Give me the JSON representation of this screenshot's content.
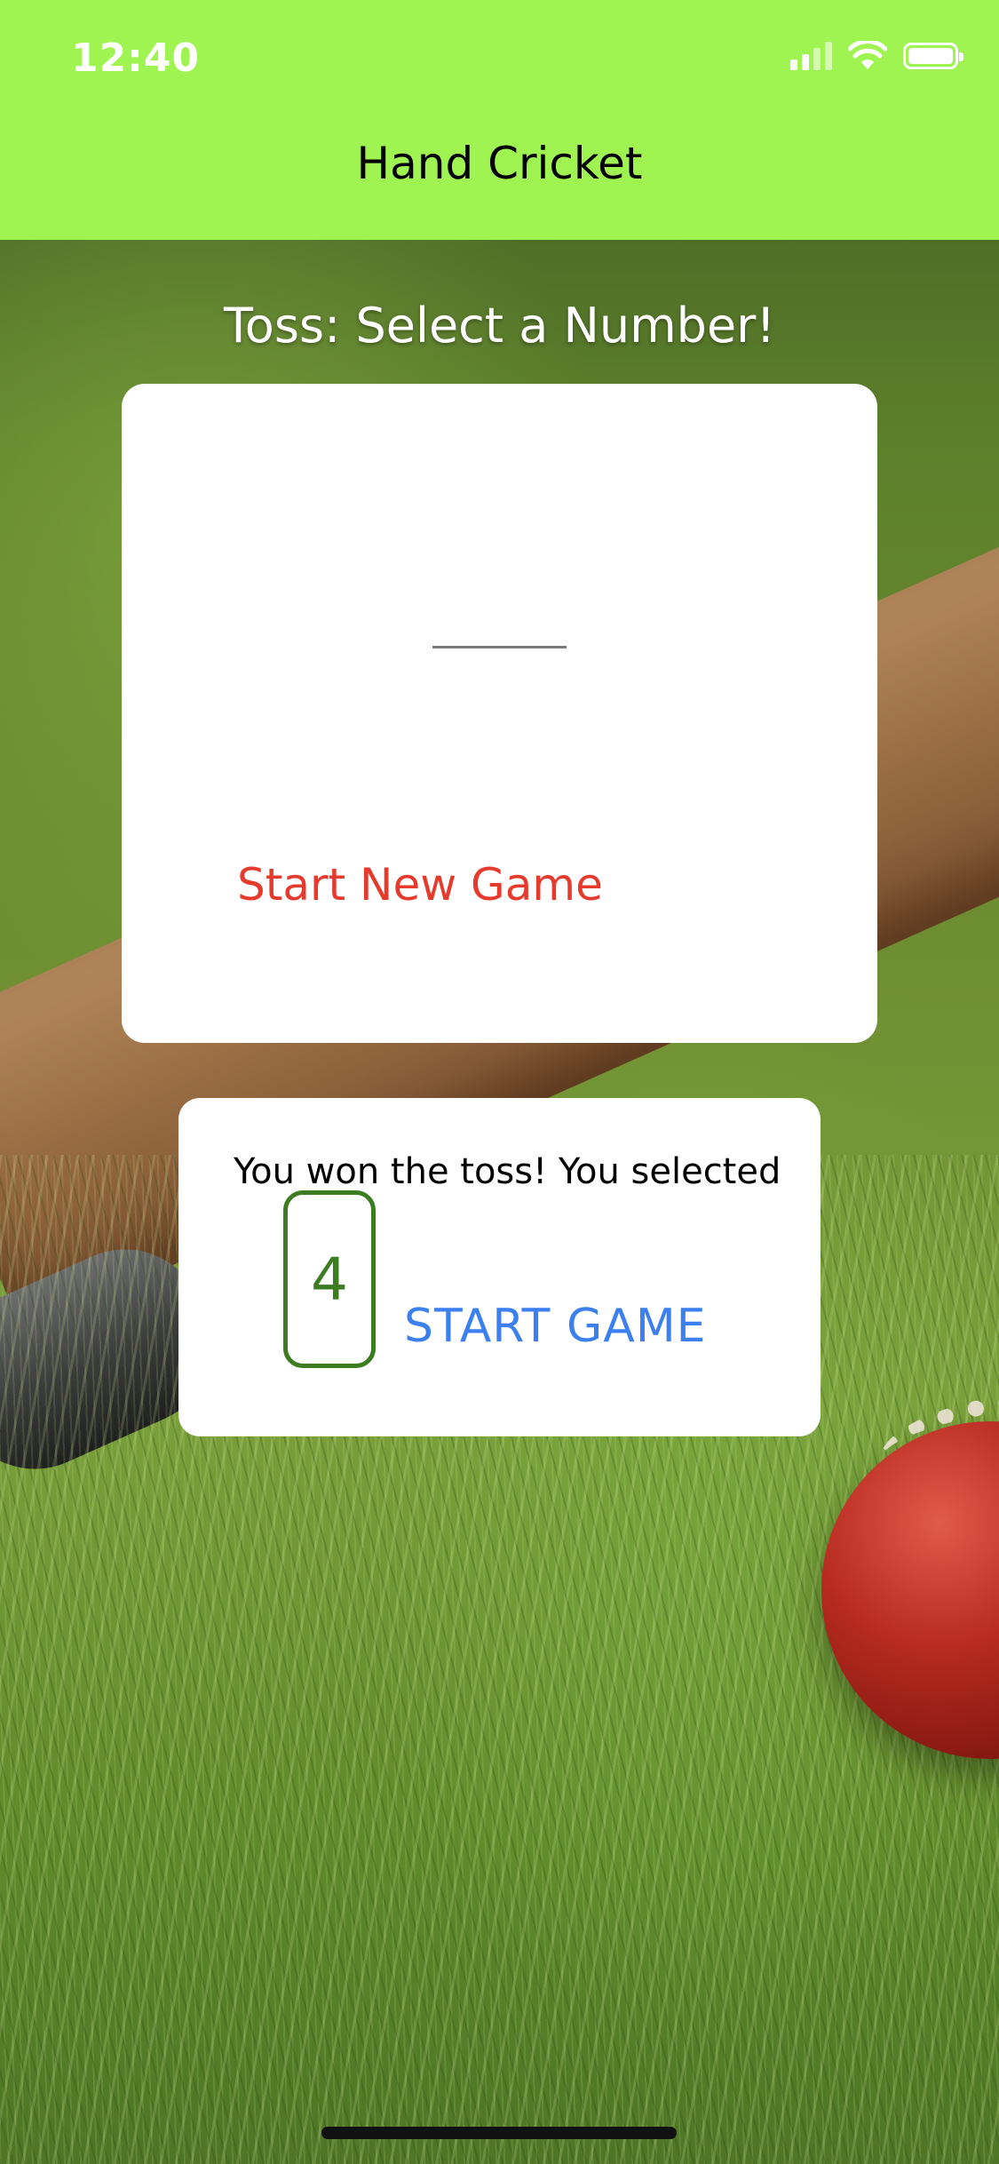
{
  "status_bar": {
    "time": "12:40"
  },
  "nav": {
    "title": "Hand Cricket"
  },
  "toss": {
    "heading": "Toss: Select a Number!"
  },
  "main_card": {
    "start_new_game_label": "Start New Game"
  },
  "result_card": {
    "message": "You won the toss! You selected",
    "selected_number": "4",
    "start_game_label": "START GAME"
  },
  "colors": {
    "nav_background": "#a0f452",
    "start_new_game": "#e53a2c",
    "start_game": "#3c80f0",
    "selected_number": "#3c7d22"
  }
}
